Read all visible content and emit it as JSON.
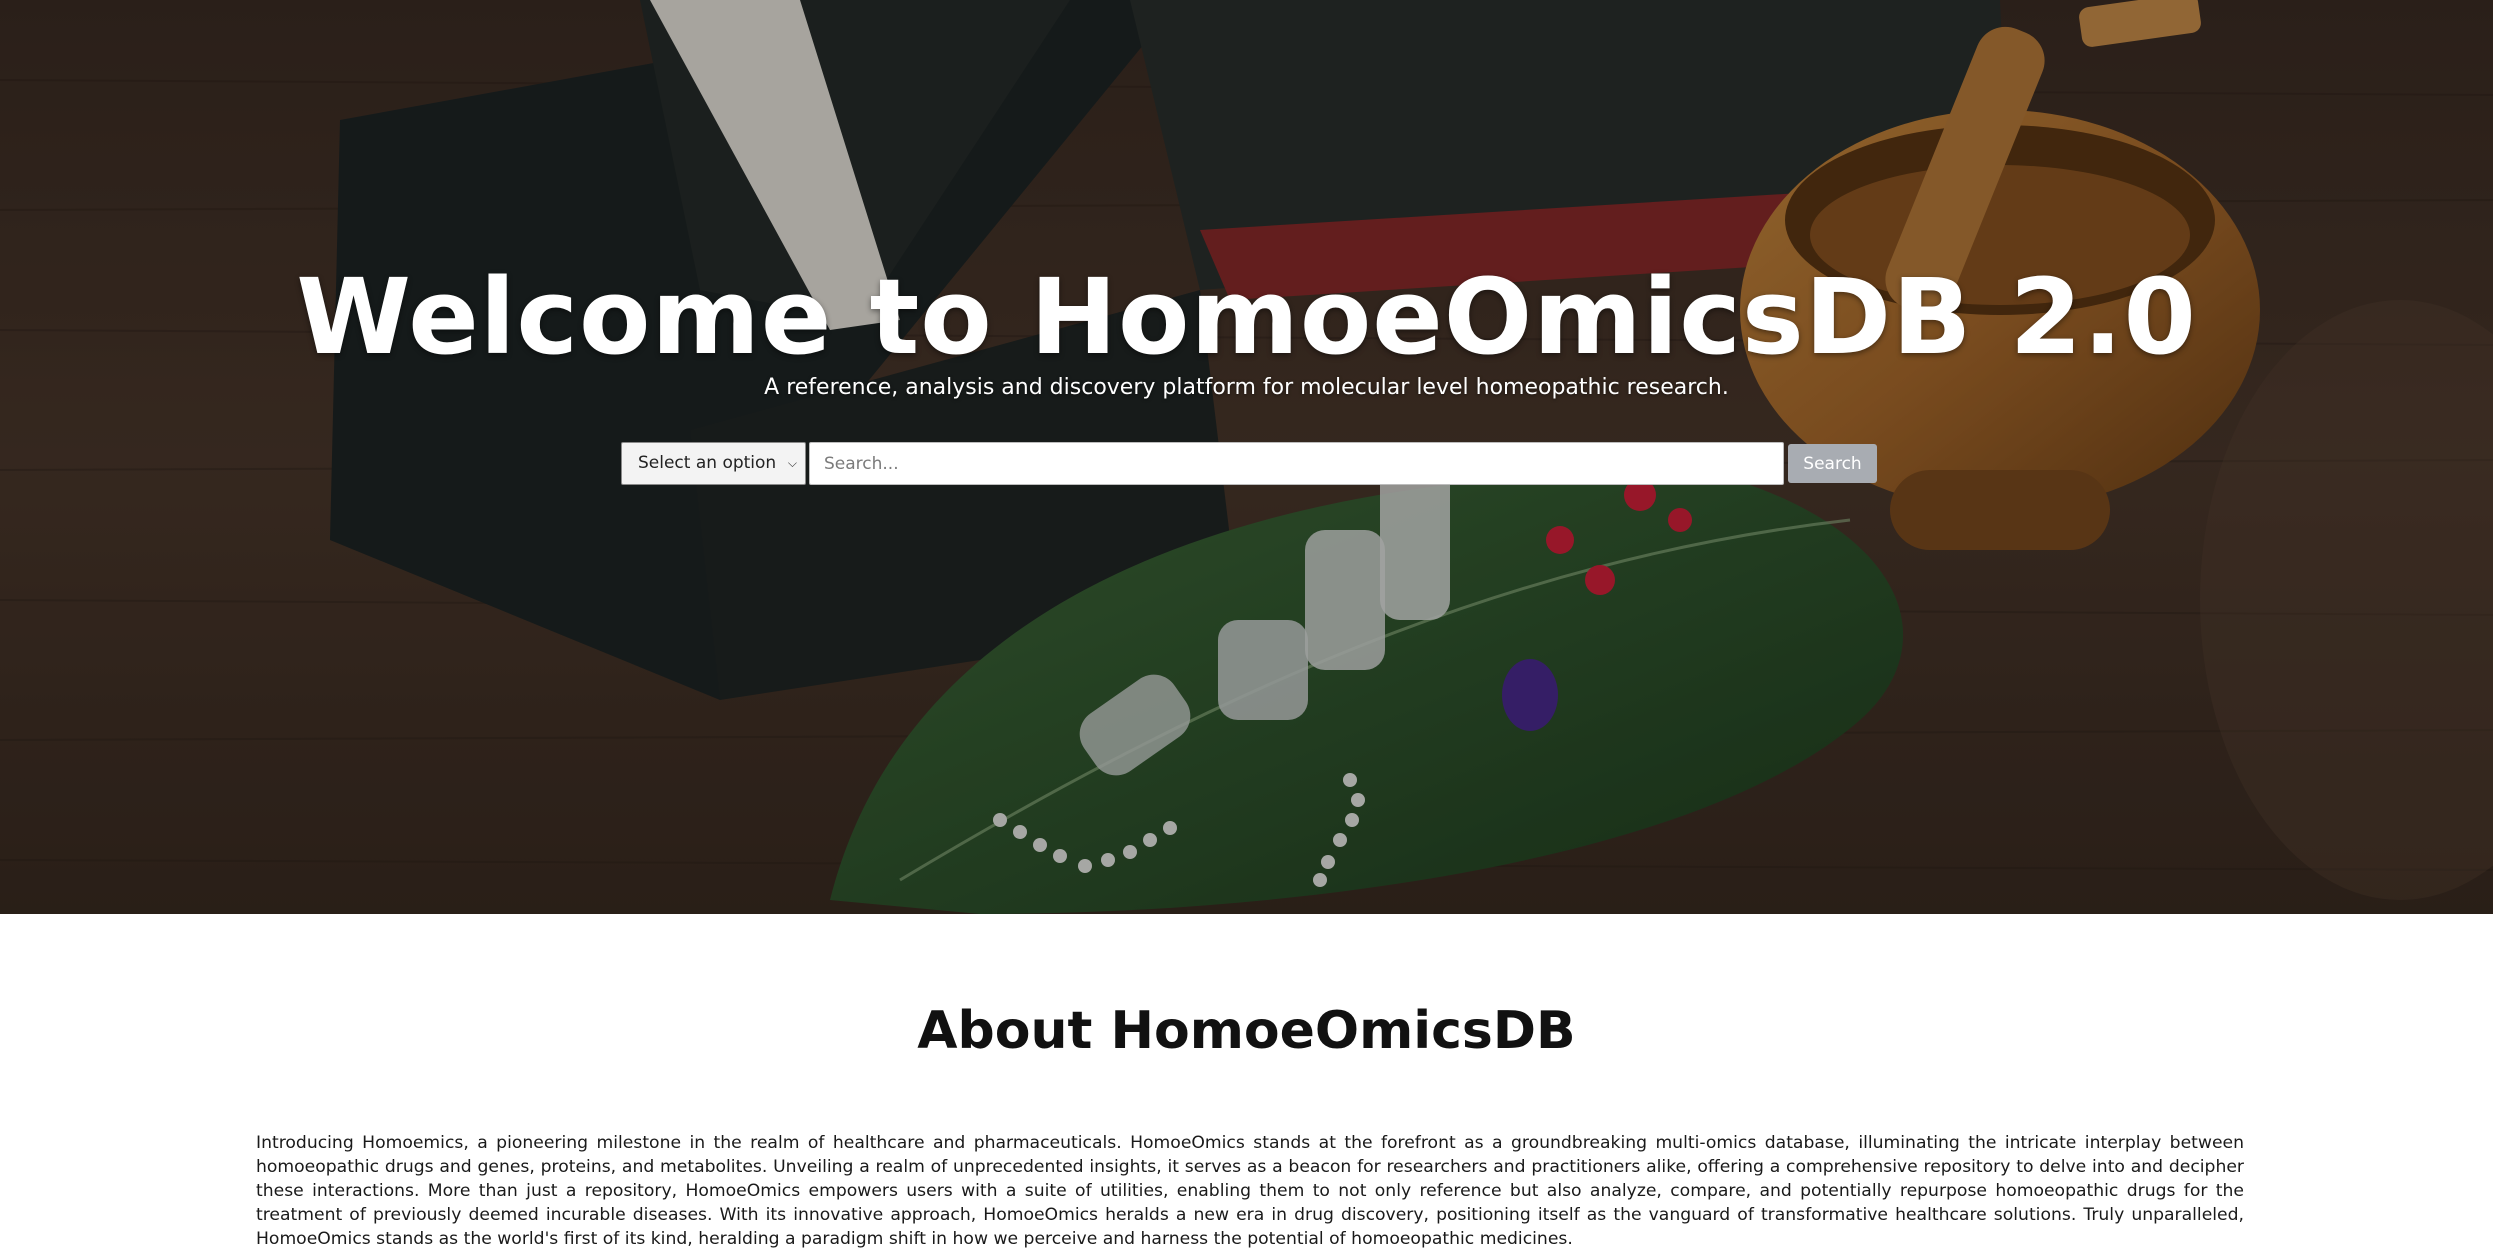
{
  "hero": {
    "title": "Welcome to HomoeOmicsDB 2.0",
    "subtitle": "A reference, analysis and discovery platform for molecular level homeopathic research.",
    "background_image": "books-mortar-pestle-homeopathic-pills-on-leaf"
  },
  "search": {
    "select_value": "Select an option",
    "placeholder": "Search...",
    "button_label": "Search"
  },
  "about": {
    "title": "About HomoeOmicsDB",
    "body": "Introducing Homoemics, a pioneering milestone in the realm of healthcare and pharmaceuticals. HomoeOmics stands at the forefront as a groundbreaking multi-omics database, illuminating the intricate interplay between homoeopathic drugs and genes, proteins, and metabolites. Unveiling a realm of unprecedented insights, it serves as a beacon for researchers and practitioners alike, offering a comprehensive repository to delve into and decipher these interactions. More than just a repository, HomoeOmics empowers users with a suite of utilities, enabling them to not only reference but also analyze, compare, and potentially repurpose homoeopathic drugs for the treatment of previously deemed incurable diseases. With its innovative approach, HomoeOmics heralds a new era in drug discovery, positioning itself as the vanguard of transformative healthcare solutions. Truly unparalleled, HomoeOmics stands as the world's first of its kind, heralding a paradigm shift in how we perceive and harness the potential of homoeopathic medicines."
  },
  "colors": {
    "hero_text": "#ffffff",
    "search_button_bg": "#a8acb2",
    "body_text": "#111111"
  }
}
